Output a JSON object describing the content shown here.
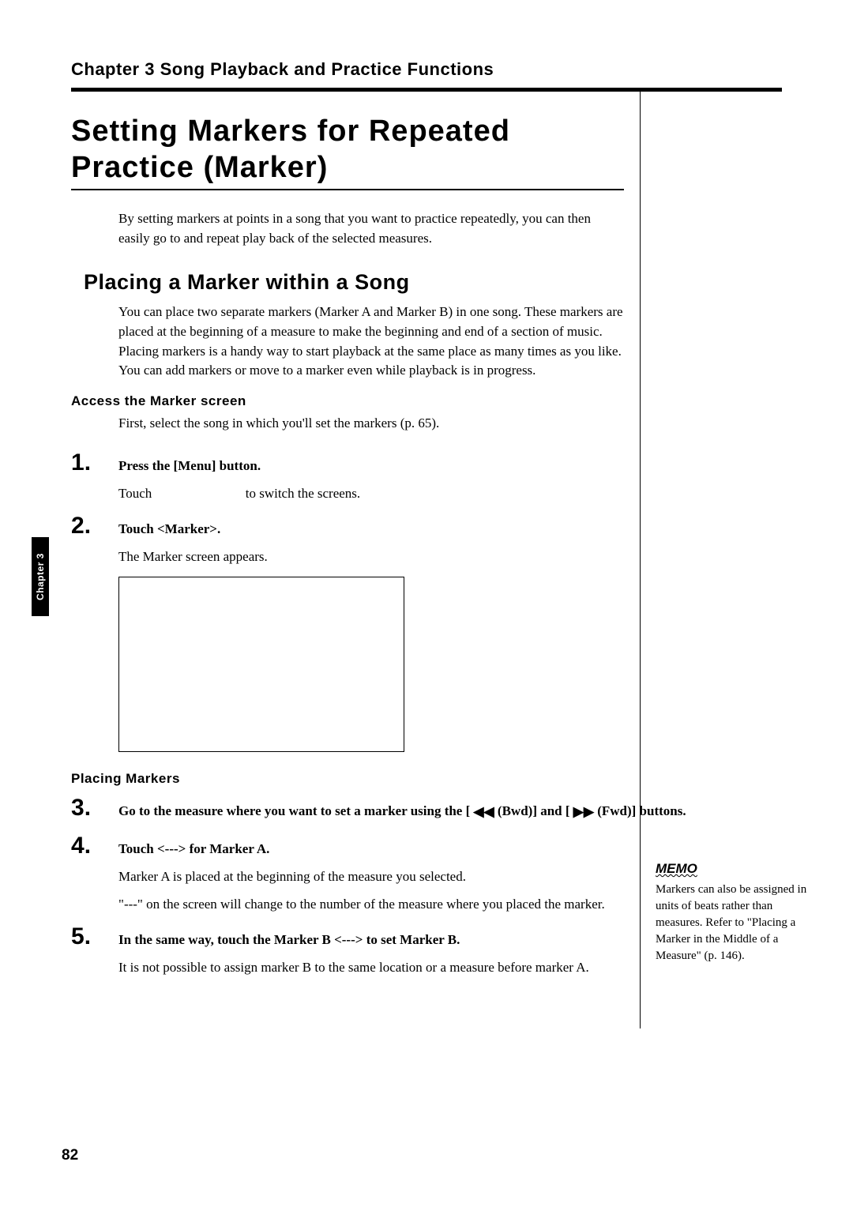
{
  "header": {
    "chapter_line": "Chapter 3 Song Playback and Practice Functions"
  },
  "title": "Setting Markers for Repeated Practice (Marker)",
  "intro": "By setting markers at points in a song that you want to practice repeatedly, you can then easily go to and repeat play back of the selected measures.",
  "subsection": {
    "heading": "Placing a Marker within a Song",
    "body": "You can place two separate markers (Marker A and Marker B) in one song. These markers are placed at the beginning of a measure to make the beginning and end of a section of music. Placing markers is a handy way to start playback at the same place as many times as you like. You can add markers or move to a marker even while playback is in progress."
  },
  "access": {
    "label": "Access the Marker screen",
    "body": "First, select the song in which you'll set the markers (p. 65)."
  },
  "steps": {
    "s1": {
      "num": "1",
      "text": "Press the [Menu] button.",
      "follow_a": "Touch",
      "follow_b": "to switch the screens."
    },
    "s2": {
      "num": "2",
      "text": "Touch <Marker>.",
      "follow": "The Marker screen appears."
    },
    "placing_label": "Placing Markers",
    "s3": {
      "num": "3",
      "text_a": "Go to the measure where you want to set a marker using the [",
      "text_b": " (Bwd)] and [",
      "text_c": " (Fwd)] buttons."
    },
    "s4": {
      "num": "4",
      "text": "Touch <---> for Marker A.",
      "follow1": "Marker A is placed at the beginning of the measure you selected.",
      "follow2": "\"---\" on the screen will change to the number of the measure where you placed the marker."
    },
    "s5": {
      "num": "5",
      "text": "In the same way, touch the Marker B <---> to set Marker B.",
      "follow": "It is not possible to assign marker B to the same location or a measure before marker A."
    }
  },
  "side_tab": "Chapter 3",
  "memo": {
    "label": "MEMO",
    "body": "Markers can also be assigned in units of beats rather than measures. Refer to \"Placing a Marker in the Middle of a Measure\" (p. 146)."
  },
  "page_number": "82",
  "icons": {
    "rew": "◀◀",
    "fwd": "▶▶"
  }
}
